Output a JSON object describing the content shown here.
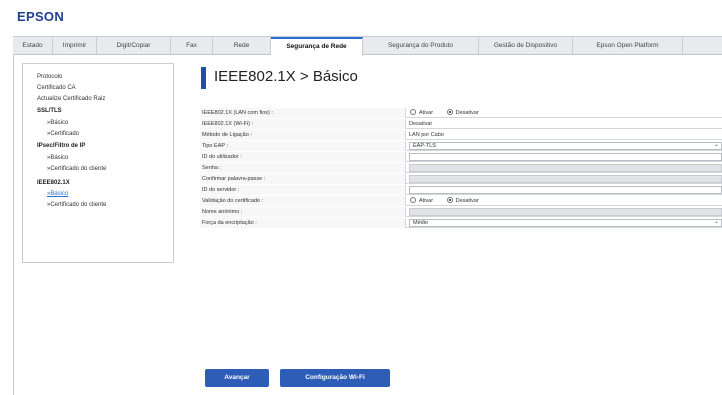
{
  "brand": {
    "logo_text": "EPSON",
    "color": "#1f3f8f"
  },
  "tabs": [
    {
      "label": "Estado",
      "active": false
    },
    {
      "label": "Imprimir",
      "active": false
    },
    {
      "label": "Digit/Copiar",
      "active": false
    },
    {
      "label": "Fax",
      "active": false
    },
    {
      "label": "Rede",
      "active": false
    },
    {
      "label": "Segurança de Rede",
      "active": true
    },
    {
      "label": "Segurança do Produto",
      "active": false
    },
    {
      "label": "Gestão de Dispositivo",
      "active": false
    },
    {
      "label": "Epson Open Platform",
      "active": false
    }
  ],
  "sidebar": {
    "items": [
      {
        "label": "Protocolo",
        "kind": "link"
      },
      {
        "label": "Certificado CA",
        "kind": "link"
      },
      {
        "label": "Actualize Certificado Raiz",
        "kind": "link"
      },
      {
        "label": "SSL/TLS",
        "kind": "head"
      },
      {
        "label": "»Básico",
        "kind": "sub"
      },
      {
        "label": "»Certificado",
        "kind": "sub"
      },
      {
        "label": "IPsec/Filtro de IP",
        "kind": "head"
      },
      {
        "label": "»Básico",
        "kind": "sub"
      },
      {
        "label": "»Certificado do cliente",
        "kind": "sub"
      },
      {
        "label": "IEEE802.1X",
        "kind": "head"
      },
      {
        "label": "»Básico",
        "kind": "active"
      },
      {
        "label": "»Certificado do cliente",
        "kind": "sub"
      }
    ]
  },
  "page": {
    "title": "IEEE802.1X > Básico",
    "accent": "#1f4fa8"
  },
  "form": {
    "rows": [
      {
        "label": "IEEE802.1X (LAN com fios) :",
        "type": "radio",
        "options": [
          "Ativar",
          "Desativar"
        ],
        "selected": "Desativar"
      },
      {
        "label": "IEEE802.1X (Wi-Fi) :",
        "type": "text",
        "value": "Desativar"
      },
      {
        "label": "Método de Ligação :",
        "type": "text",
        "value": "LAN por Cabo"
      },
      {
        "label": "Tipo EAP :",
        "type": "select",
        "value": "EAP-TLS"
      },
      {
        "label": "ID do utilizador :",
        "type": "input",
        "value": "",
        "disabled": false
      },
      {
        "label": "Senha :",
        "type": "input",
        "value": "",
        "disabled": true
      },
      {
        "label": "Confirmar palavra-passe :",
        "type": "input",
        "value": "",
        "disabled": true
      },
      {
        "label": "ID do servidor :",
        "type": "input",
        "value": "",
        "disabled": false
      },
      {
        "label": "Validação do certificado :",
        "type": "radio",
        "options": [
          "Ativar",
          "Desativar"
        ],
        "selected": "Desativar"
      },
      {
        "label": "Nome anónimo :",
        "type": "input",
        "value": "",
        "disabled": true
      },
      {
        "label": "Força da encriptação :",
        "type": "select",
        "value": "Médio"
      }
    ]
  },
  "buttons": {
    "next": "Avançar",
    "wifi_setup": "Configuração Wi-Fi",
    "color": "#2e5db8"
  }
}
